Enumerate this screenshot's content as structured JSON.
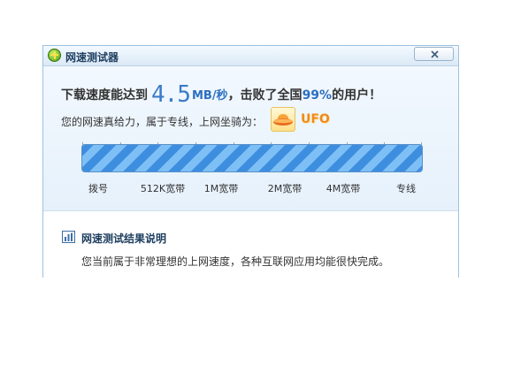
{
  "window": {
    "title": "网速测试器",
    "close_label": "×"
  },
  "result": {
    "prefix": "下载速度能达到",
    "speed_value": "4.5",
    "speed_unit": "MB/秒",
    "middle": "，击败了全国",
    "percent": "99%",
    "suffix": "的用户！"
  },
  "rank": {
    "text": "您的网速真给力，属于专线，上网坐骑为：",
    "vehicle_name": "UFO",
    "vehicle_icon": "ufo-icon"
  },
  "speed_bar": {
    "progress": 1.0,
    "fill_color": "#3e8ee0",
    "labels": [
      "拨号",
      "512K宽带",
      "1M宽带",
      "2M宽带",
      "4M宽带",
      "专线"
    ]
  },
  "explanation": {
    "title": "网速测试结果说明",
    "description": "您当前属于非常理想的上网速度，各种互联网应用均能很快完成。",
    "icon": "bar-chart-icon"
  }
}
